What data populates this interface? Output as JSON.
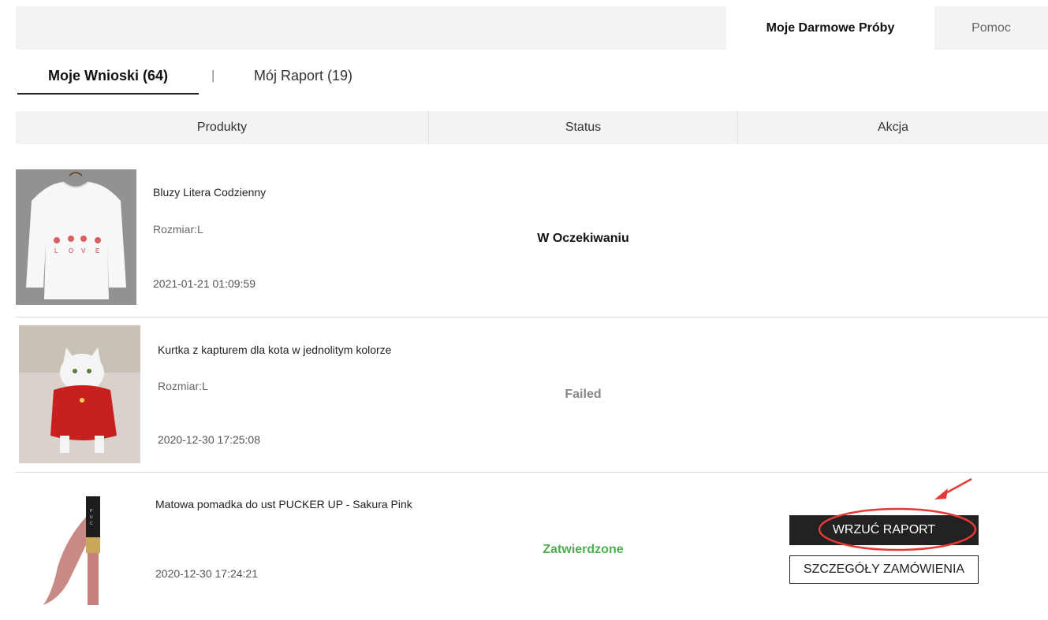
{
  "top_tabs": {
    "active": "Moje Darmowe Próby",
    "help": "Pomoc"
  },
  "sub_tabs": {
    "requests": "Moje Wnioski (64)",
    "separator": "|",
    "report": "Mój Raport (19)"
  },
  "table": {
    "headers": [
      "Produkty",
      "Status",
      "Akcja"
    ]
  },
  "rows": [
    {
      "name": "Bluzy Litera Codzienny",
      "size": "Rozmiar:L",
      "date": "2021-01-21 01:09:59",
      "status": "W Oczekiwaniu",
      "status_color": "#111111",
      "thumb": "white-sweatshirt"
    },
    {
      "name": "Kurtka z kapturem dla kota w jednolitym kolorze",
      "size": "Rozmiar:L",
      "date": "2020-12-30 17:25:08",
      "status": "Failed",
      "status_color": "#888888",
      "thumb": "cat-red-hoodie"
    },
    {
      "name": "Matowa pomadka do ust PUCKER UP - Sakura Pink",
      "size": "",
      "date": "2020-12-30 17:24:21",
      "status": "Zatwierdzone",
      "status_color": "#4caf50",
      "thumb": "lipstick",
      "actions": {
        "upload_report": "WRZUĆ RAPORT",
        "order_details": "SZCZEGÓŁY ZAMÓWIENIA"
      }
    }
  ],
  "colors": {
    "annotation": "#e53935",
    "header_bg": "#f3f3f3"
  }
}
